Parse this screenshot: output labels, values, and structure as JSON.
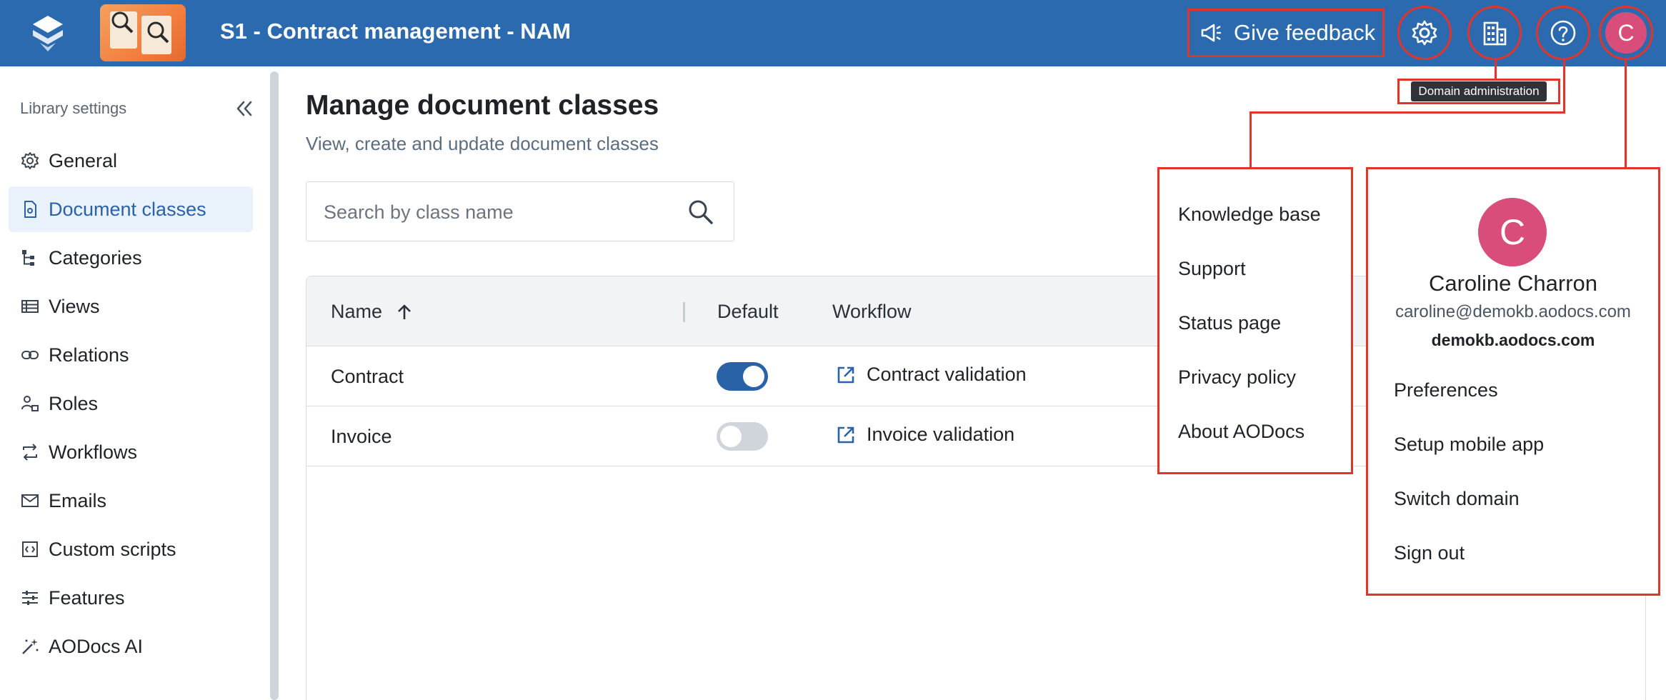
{
  "header": {
    "app_title": "S1 - Contract management - NAM",
    "feedback_label": "Give feedback",
    "avatar_initial": "C",
    "tooltip": "Domain administration",
    "colors": {
      "bar": "#2c6ab0",
      "highlight": "#e1342a",
      "avatar": "#d94d7a"
    }
  },
  "sidebar": {
    "heading": "Library settings",
    "items": [
      {
        "label": "General",
        "icon": "gear-icon",
        "active": false
      },
      {
        "label": "Document classes",
        "icon": "document-class-icon",
        "active": true
      },
      {
        "label": "Categories",
        "icon": "tree-icon",
        "active": false
      },
      {
        "label": "Views",
        "icon": "list-icon",
        "active": false
      },
      {
        "label": "Relations",
        "icon": "link-icon",
        "active": false
      },
      {
        "label": "Roles",
        "icon": "roles-icon",
        "active": false
      },
      {
        "label": "Workflows",
        "icon": "workflow-icon",
        "active": false
      },
      {
        "label": "Emails",
        "icon": "mail-icon",
        "active": false
      },
      {
        "label": "Custom scripts",
        "icon": "code-icon",
        "active": false
      },
      {
        "label": "Features",
        "icon": "sliders-icon",
        "active": false
      },
      {
        "label": "AODocs AI",
        "icon": "magic-wand-icon",
        "active": false
      }
    ]
  },
  "main": {
    "title": "Manage document classes",
    "subtitle": "View, create and update document classes",
    "search_placeholder": "Search by class name",
    "columns": {
      "name": "Name",
      "default": "Default",
      "workflow": "Workflow"
    },
    "rows": [
      {
        "name": "Contract",
        "default": true,
        "workflow": "Contract validation"
      },
      {
        "name": "Invoice",
        "default": false,
        "workflow": "Invoice validation"
      }
    ]
  },
  "help_menu": {
    "items": [
      "Knowledge base",
      "Support",
      "Status page",
      "Privacy policy",
      "About AODocs"
    ]
  },
  "user_menu": {
    "initial": "C",
    "name": "Caroline Charron",
    "email": "caroline@demokb.aodocs.com",
    "domain": "demokb.aodocs.com",
    "items": [
      "Preferences",
      "Setup mobile app",
      "Switch domain",
      "Sign out"
    ]
  }
}
